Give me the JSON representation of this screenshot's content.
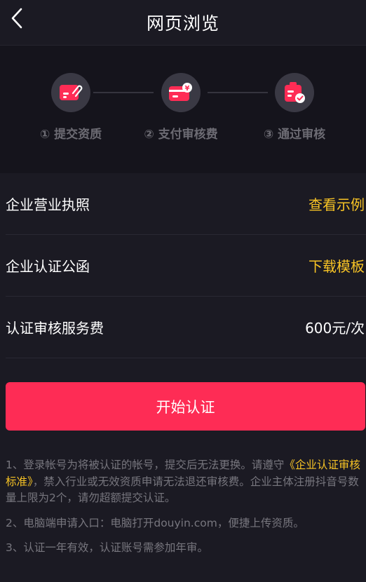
{
  "header": {
    "title": "网页浏览",
    "back_icon": "chevron-left-icon"
  },
  "steps": [
    {
      "label": "① 提交资质",
      "icon": "license-card-icon"
    },
    {
      "label": "② 支付审核费",
      "icon": "payment-card-icon"
    },
    {
      "label": "③ 通过审核",
      "icon": "approved-badge-icon"
    }
  ],
  "rows": [
    {
      "label": "企业营业执照",
      "action": "查看示例"
    },
    {
      "label": "企业认证公函",
      "action": "下载模板"
    },
    {
      "label": "认证审核服务费",
      "value": "600元/次"
    }
  ],
  "start_button": "开始认证",
  "notes": {
    "note1_prefix": "1、登录帐号为将被认证的帐号，提交后无法更换。请遵守",
    "note1_link": "《企业认证审核标准》",
    "note1_suffix": "，禁入行业或无效资质申请无法退还审核费。企业主体注册抖音号数量上限为2个，请勿超额提交认证。",
    "note2": "2、电脑端申请入口：电脑打开douyin.com，便捷上传资质。",
    "note3": "3、认证一年有效，认证账号需参加年审。"
  },
  "colors": {
    "background": "#1b1a23",
    "accent": "#fe2c55",
    "link": "#f7c325",
    "muted_text": "#77767e"
  }
}
